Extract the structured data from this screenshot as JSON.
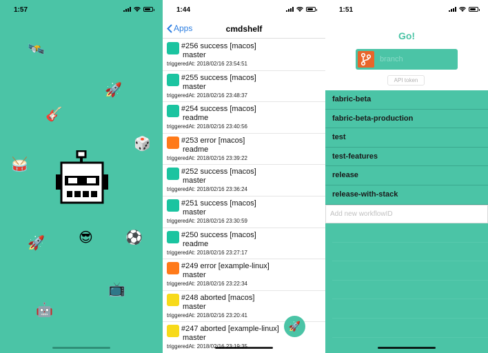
{
  "screen1": {
    "time": "1:57",
    "emojis": [
      "🛰️",
      "🚀",
      "🎸",
      "🎲",
      "🥁",
      "🚀",
      "😎",
      "⚽",
      "📺",
      "🤖"
    ],
    "logo_icon": "robot-icon"
  },
  "screen2": {
    "time": "1:44",
    "back_label": "Apps",
    "title": "cmdshelf",
    "fab_icon": "🚀",
    "colors": {
      "success": "#1bc4a0",
      "error": "#ff7a1a",
      "aborted": "#f7da1a"
    },
    "builds": [
      {
        "title": "#256 success [macos]",
        "branch": "master",
        "triggered": "triggeredAt: 2018/02/16 23:54:51",
        "status": "success"
      },
      {
        "title": "#255 success [macos]",
        "branch": "master",
        "triggered": "triggeredAt: 2018/02/16 23:48:37",
        "status": "success"
      },
      {
        "title": "#254 success [macos]",
        "branch": "readme",
        "triggered": "triggeredAt: 2018/02/16 23:40:56",
        "status": "success"
      },
      {
        "title": "#253 error [macos]",
        "branch": "readme",
        "triggered": "triggeredAt: 2018/02/16 23:39:22",
        "status": "error"
      },
      {
        "title": "#252 success [macos]",
        "branch": "master",
        "triggered": "triggeredAt: 2018/02/16 23:36:24",
        "status": "success"
      },
      {
        "title": "#251 success [macos]",
        "branch": "master",
        "triggered": "triggeredAt: 2018/02/16 23:30:59",
        "status": "success"
      },
      {
        "title": "#250 success [macos]",
        "branch": "readme",
        "triggered": "triggeredAt: 2018/02/16 23:27:17",
        "status": "success"
      },
      {
        "title": "#249 error [example-linux]",
        "branch": "master",
        "triggered": "triggeredAt: 2018/02/16 23:22:34",
        "status": "error"
      },
      {
        "title": "#248 aborted [macos]",
        "branch": "master",
        "triggered": "triggeredAt: 2018/02/16 23:20:41",
        "status": "aborted"
      },
      {
        "title": "#247 aborted [example-linux]",
        "branch": "master",
        "triggered": "triggeredAt: 2018/02/16 23:19:35",
        "status": "aborted"
      }
    ]
  },
  "screen3": {
    "time": "1:51",
    "go_label": "Go!",
    "branch_placeholder": "branch",
    "api_token_label": "API token",
    "workflows": [
      "fabric-beta",
      "fabric-beta-production",
      "test",
      "test-features",
      "release",
      "release-with-stack"
    ],
    "new_workflow_placeholder": "Add new workflowID"
  }
}
